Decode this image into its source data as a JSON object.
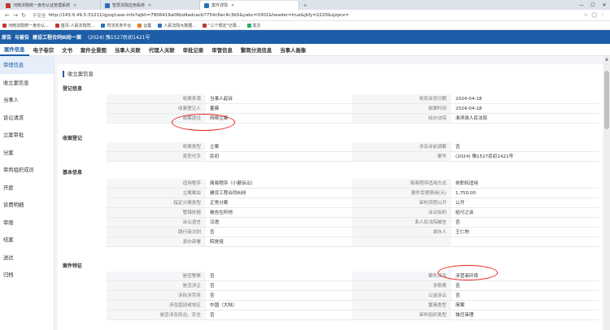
{
  "browser": {
    "tabs": [
      {
        "label": "河南法院统一身份认证管理系统",
        "color": "#c0392b"
      },
      {
        "label": "智慧法院应用系统",
        "color": "#2c6fb7"
      },
      {
        "label": "案件详情",
        "color": "#2c6fb7"
      }
    ],
    "url": "http://143.0.49.5:31211/qjxq/case-info?ajbh=7806419a06bd4adcacb7754c6ec4c3b5&yabc=0301&header=true&jbfy=2220&sjzpcx=",
    "security": "不安全",
    "bookmarks": [
      {
        "label": "河南法院统一身份认...",
        "color": "#c0392b"
      },
      {
        "label": "首页-人民法院司...",
        "color": "#c0392b"
      },
      {
        "label": "司法实务平台",
        "color": "#2c6fb7"
      },
      {
        "label": "云集",
        "color": "#e67e22"
      },
      {
        "label": "人民法院大数据...",
        "color": "#2c6fb7"
      },
      {
        "label": "\"三个规定\"记录...",
        "color": "#c0392b"
      },
      {
        "label": "发文",
        "color": "#27ae60"
      }
    ]
  },
  "header": {
    "prefix": "原告",
    "title_mid": "与被告",
    "title_end": "建设工程合同纠纷一案",
    "caseno": "(2024) 豫1527民初1421号"
  },
  "tabs": [
    "案件信息",
    "电子卷宗",
    "文书",
    "案件全景图",
    "当事人关联",
    "代理人关联",
    "审批记录",
    "审管信息",
    "繁简分流信息",
    "当事人画像"
  ],
  "sidebar": [
    "审理信息",
    "收立案信息",
    "当事人",
    "诉讼请求",
    "立案审批",
    "分案",
    "审判组织成员",
    "开庭",
    "诉费明细",
    "审限",
    "结案",
    "送达",
    "归档"
  ],
  "panel_title": "收立案信息",
  "sections": [
    {
      "title": "登记信息",
      "rows": [
        [
          "收案来源",
          "当事人起诉",
          "收到诉状日期",
          "2024-04-18"
        ],
        [
          "收案登记人",
          "董薇",
          "收案时间",
          "2024-04-18"
        ],
        [
          "收案途径",
          "网络立案",
          "经办法院",
          "淮滨县人民法院"
        ]
      ]
    },
    {
      "title": "收案登记",
      "rows": [
        [
          "收案类型",
          "立案",
          "涉及诉前调解",
          "否"
        ],
        [
          "类型代字",
          "民初",
          "案号",
          "(2024) 豫1527民初1421号"
        ]
      ]
    },
    {
      "title": "基本信息",
      "rows": [
        [
          "适用程序",
          "简易程序（小额诉讼）",
          "简易程序适用方式",
          "依职权适用"
        ],
        [
          "立案案由",
          "建设工程合同纠纷",
          "案件受理费用(元)",
          "1,750.00"
        ],
        [
          "指定分案类型",
          "正常分案",
          "审判流程公开",
          "公开"
        ],
        [
          "管辖依据",
          "被告住所地",
          "诉讼标的",
          "给付之诉"
        ],
        [
          "诉讼语言",
          "汉语",
          "系人民法院被告",
          "否"
        ],
        [
          "践行级次别",
          "否",
          "承办人",
          "王仁地"
        ],
        [
          "承办部署",
          "院党组",
          "",
          ""
        ]
      ]
    },
    {
      "title": "案件特征",
      "rows": [
        [
          "是否警察",
          "否",
          "案件涉及",
          "涉营商环境"
        ],
        [
          "是否涉企",
          "否",
          "涉税案",
          "否"
        ],
        [
          "涉执涉劳务",
          "否",
          "公益诉讼",
          "否"
        ],
        [
          "涉及国别或地区",
          "中国（大陆）",
          "繁简类型",
          "简案"
        ],
        [
          "是否涉及政治、安全",
          "否",
          "审判组织类型",
          "独任审理"
        ]
      ]
    }
  ]
}
